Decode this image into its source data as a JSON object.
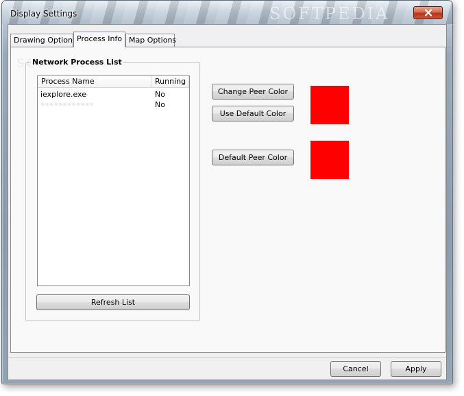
{
  "window": {
    "title": "Display Settings",
    "watermark": "SOFTPEDIA"
  },
  "tabs": [
    {
      "label": "Drawing Options",
      "active": false
    },
    {
      "label": "Process Info",
      "active": true
    },
    {
      "label": "Map Options",
      "active": false
    }
  ],
  "network_process_list": {
    "title": "Network Process List",
    "columns": [
      "Process Name",
      "Running"
    ],
    "rows": [
      {
        "name": "iexplore.exe",
        "running": "No",
        "redacted": false
      },
      {
        "name": "••••••••••••",
        "running": "No",
        "redacted": true
      }
    ],
    "refresh_label": "Refresh List"
  },
  "peer_colors": {
    "change_label": "Change Peer Color",
    "use_default_label": "Use Default Color",
    "default_label": "Default Peer Color",
    "peer_color": "#ff0000",
    "default_color": "#ff0000"
  },
  "footer": {
    "cancel_label": "Cancel",
    "apply_label": "Apply"
  }
}
